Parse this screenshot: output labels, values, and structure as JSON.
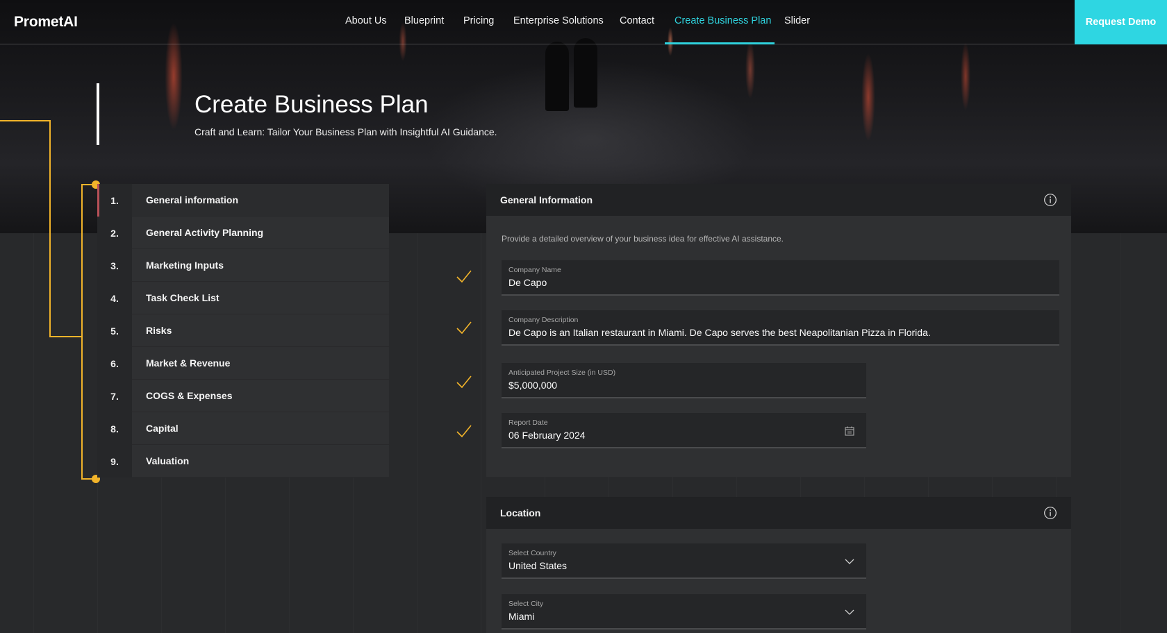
{
  "nav": {
    "logo": "PrometAI",
    "links": [
      {
        "label": "About Us"
      },
      {
        "label": "Blueprint"
      },
      {
        "label": "Pricing"
      },
      {
        "label": "Enterprise Solutions"
      },
      {
        "label": "Contact"
      },
      {
        "label": "Create Business Plan",
        "active": true
      },
      {
        "label": "Slider"
      }
    ],
    "cta": "Request Demo",
    "accent_color": "#2ed6e2"
  },
  "hero": {
    "title": "Create Business Plan",
    "subtitle": "Craft and Learn: Tailor Your Business Plan with Insightful AI Guidance."
  },
  "steps": [
    {
      "number": "1.",
      "label": "General information",
      "active": true
    },
    {
      "number": "2.",
      "label": "General Activity Planning"
    },
    {
      "number": "3.",
      "label": "Marketing Inputs"
    },
    {
      "number": "4.",
      "label": "Task Check List"
    },
    {
      "number": "5.",
      "label": "Risks"
    },
    {
      "number": "6.",
      "label": "Market & Revenue"
    },
    {
      "number": "7.",
      "label": "COGS & Expenses"
    },
    {
      "number": "8.",
      "label": "Capital"
    },
    {
      "number": "9.",
      "label": "Valuation"
    }
  ],
  "general_info": {
    "title": "General Information",
    "description": "Provide a detailed overview of your business idea for effective AI assistance.",
    "fields": {
      "company_name": {
        "label": "Company Name",
        "value": "De Capo"
      },
      "company_description": {
        "label": "Company Description",
        "value": "De Capo is an Italian restaurant in Miami. De Capo serves the best Neapolitanian Pizza in Florida."
      },
      "project_size": {
        "label": "Anticipated Project Size (in USD)",
        "value": "$5,000,000"
      },
      "report_date": {
        "label": "Report Date",
        "value": "06 February 2024"
      }
    }
  },
  "location": {
    "title": "Location",
    "fields": {
      "country": {
        "label": "Select Country",
        "value": "United States"
      },
      "city": {
        "label": "Select City",
        "value": "Miami"
      }
    }
  },
  "colors": {
    "connector": "#f2b42a",
    "active_step_marker": "#b75058"
  }
}
